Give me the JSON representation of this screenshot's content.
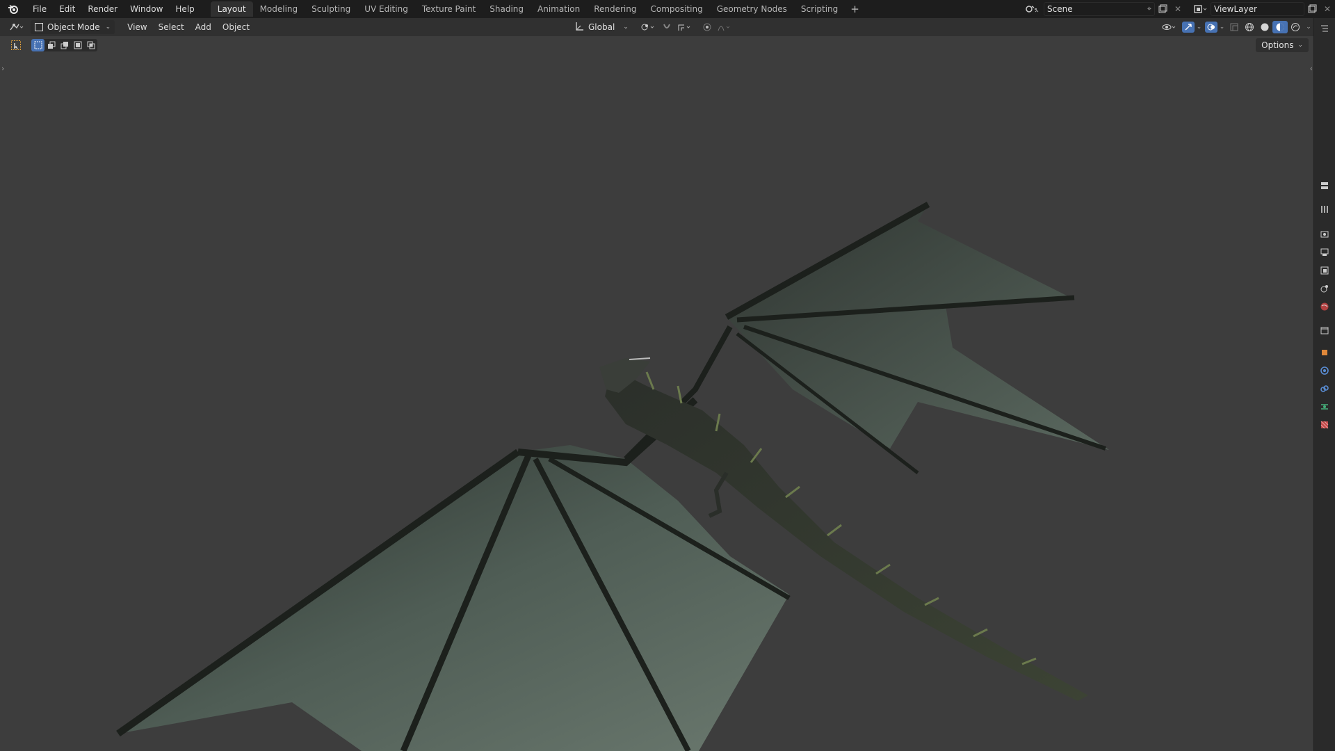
{
  "menu": {
    "items": [
      "File",
      "Edit",
      "Render",
      "Window",
      "Help"
    ]
  },
  "workspaces": {
    "tabs": [
      "Layout",
      "Modeling",
      "Sculpting",
      "UV Editing",
      "Texture Paint",
      "Shading",
      "Animation",
      "Rendering",
      "Compositing",
      "Geometry Nodes",
      "Scripting"
    ],
    "active": "Layout",
    "add_label": "+"
  },
  "scene": {
    "name": "Scene"
  },
  "view_layer": {
    "name": "ViewLayer"
  },
  "header": {
    "mode": "Object Mode",
    "menus": [
      "View",
      "Select",
      "Add",
      "Object"
    ],
    "transform_orientation": "Global",
    "options_label": "Options"
  },
  "colors": {
    "topbar": "#1d1d1d",
    "header": "#303030",
    "viewport": "#3d3d3d",
    "accent": "#4772b3",
    "wing_membrane": "#4c5a52",
    "wing_bone": "#1d211d"
  },
  "icons": {
    "app_logo": "blender-logo-icon",
    "editor_type": "3d-viewport-icon",
    "properties": [
      "tool-icon",
      "render-icon",
      "output-icon",
      "view-layer-icon",
      "scene-icon",
      "world-icon",
      "collection-icon",
      "object-icon",
      "modifier-icon",
      "particles-icon",
      "physics-icon",
      "constraints-icon",
      "data-icon",
      "material-icon"
    ]
  }
}
